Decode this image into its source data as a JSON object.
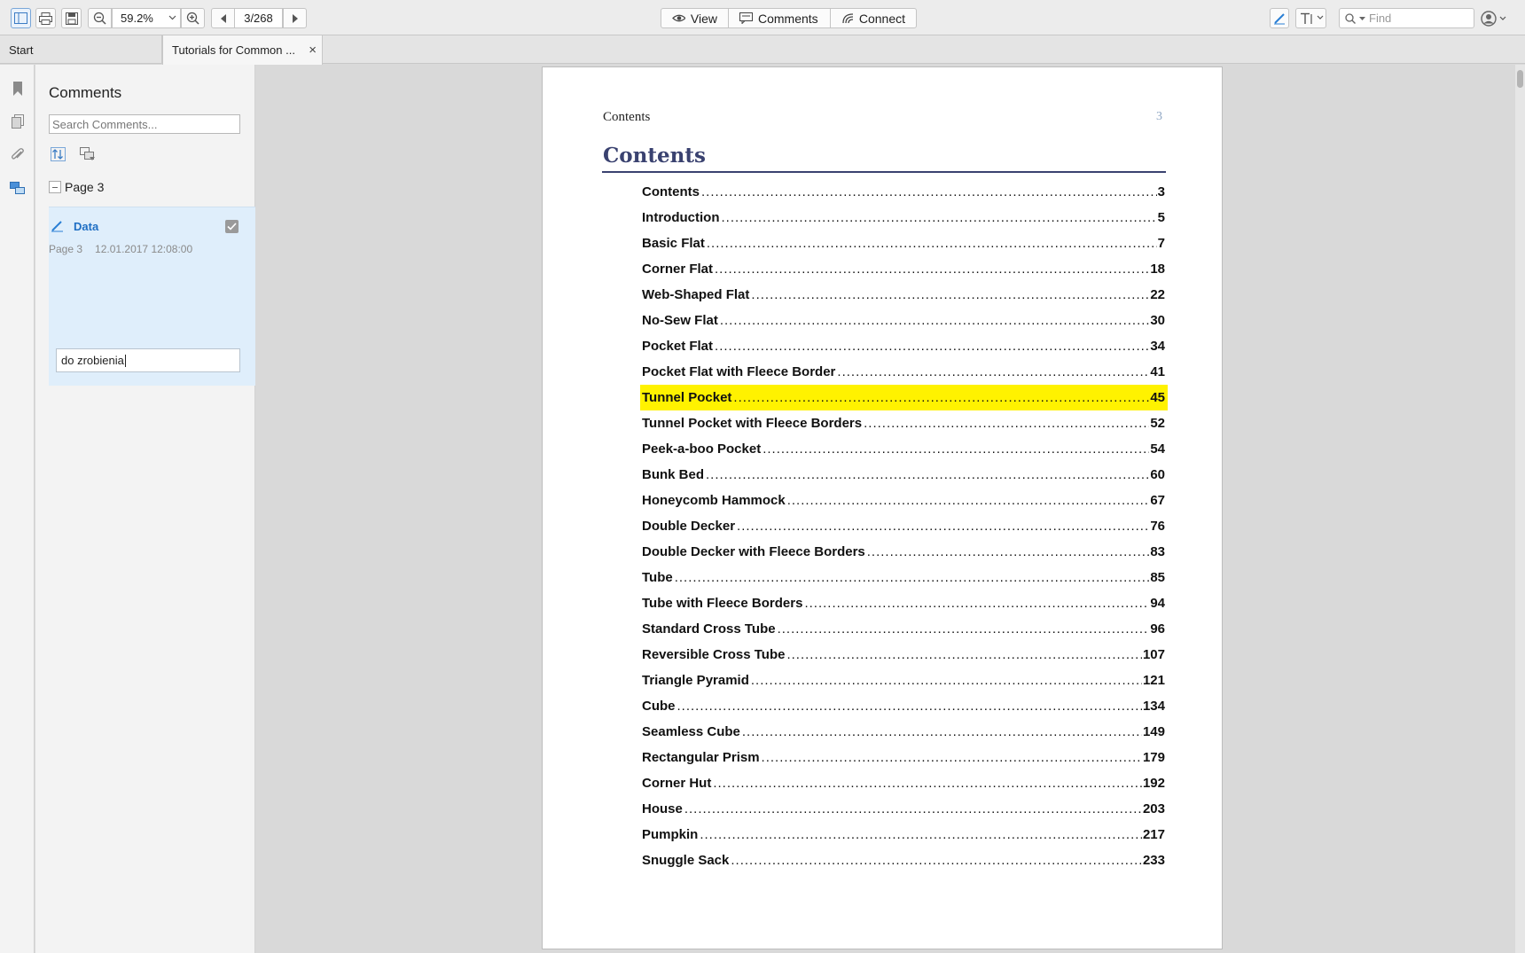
{
  "toolbar": {
    "zoom": "59.2%",
    "page_indicator": "3/268",
    "view_label": "View",
    "comments_label": "Comments",
    "connect_label": "Connect",
    "find_placeholder": "Find"
  },
  "tabs": {
    "start": "Start",
    "document": "Tutorials for Common ..."
  },
  "comments_panel": {
    "title": "Comments",
    "search_placeholder": "Search Comments...",
    "group_label": "Page 3",
    "comment": {
      "author": "Data",
      "page": "Page 3",
      "timestamp": "12.01.2017 12:08:00",
      "reply_text": "do zrobienia"
    }
  },
  "document": {
    "header_left": "Contents",
    "header_page": "3",
    "heading": "Contents",
    "toc": [
      {
        "title": "Contents",
        "page": "3"
      },
      {
        "title": "Introduction",
        "page": "5"
      },
      {
        "title": "Basic Flat",
        "page": "7"
      },
      {
        "title": "Corner Flat",
        "page": "18"
      },
      {
        "title": "Web-Shaped Flat",
        "page": "22"
      },
      {
        "title": "No-Sew Flat",
        "page": "30"
      },
      {
        "title": "Pocket Flat",
        "page": "34"
      },
      {
        "title": "Pocket Flat with Fleece Border",
        "page": "41"
      },
      {
        "title": "Tunnel Pocket",
        "page": "45",
        "highlighted": true
      },
      {
        "title": "Tunnel Pocket with Fleece Borders",
        "page": "52"
      },
      {
        "title": "Peek-a-boo Pocket",
        "page": "54"
      },
      {
        "title": "Bunk Bed",
        "page": "60"
      },
      {
        "title": "Honeycomb Hammock",
        "page": "67"
      },
      {
        "title": "Double Decker",
        "page": "76"
      },
      {
        "title": "Double Decker with Fleece Borders",
        "page": "83"
      },
      {
        "title": "Tube",
        "page": "85"
      },
      {
        "title": "Tube with Fleece Borders",
        "page": "94"
      },
      {
        "title": "Standard Cross Tube",
        "page": "96"
      },
      {
        "title": "Reversible Cross Tube",
        "page": "107"
      },
      {
        "title": "Triangle Pyramid",
        "page": "121"
      },
      {
        "title": "Cube",
        "page": "134"
      },
      {
        "title": "Seamless Cube",
        "page": "149"
      },
      {
        "title": "Rectangular Prism",
        "page": "179"
      },
      {
        "title": "Corner Hut",
        "page": "192"
      },
      {
        "title": "House",
        "page": "203"
      },
      {
        "title": "Pumpkin",
        "page": "217"
      },
      {
        "title": "Snuggle Sack",
        "page": "233"
      }
    ]
  },
  "colors": {
    "accent_blue": "#1f6fc4",
    "heading": "#3a4270",
    "highlight": "#fff200",
    "comment_bg": "#dfeefb"
  }
}
